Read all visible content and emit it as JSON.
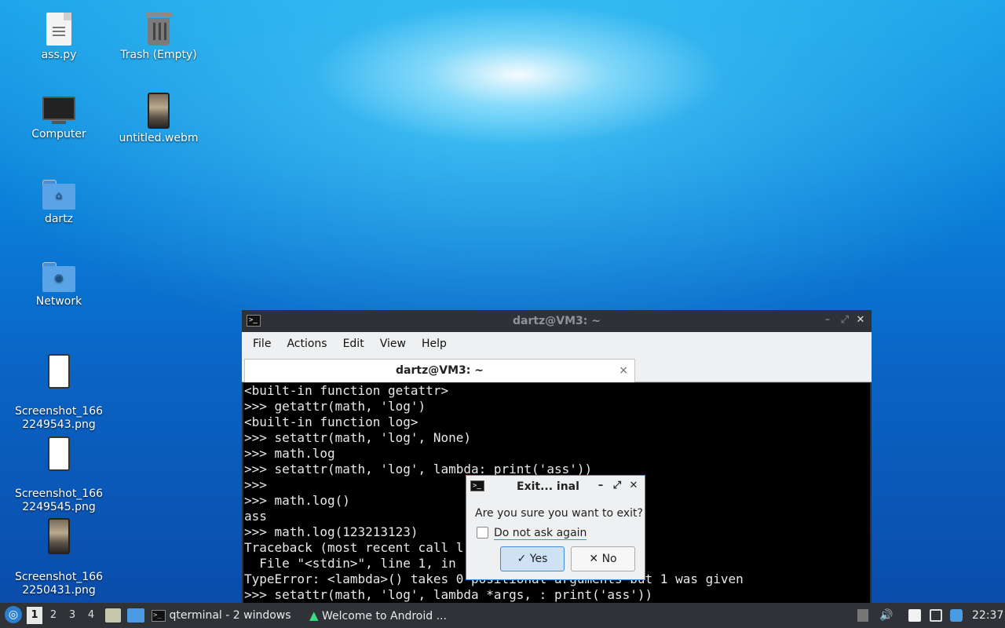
{
  "desktop": {
    "icons": [
      {
        "label": "ass.py",
        "icon": "python-file-icon"
      },
      {
        "label": "Trash (Empty)",
        "icon": "trash-icon"
      },
      {
        "label": "Computer",
        "icon": "computer-icon"
      },
      {
        "label": "untitled.webm",
        "icon": "video-file-icon"
      },
      {
        "label": "dartz",
        "icon": "home-folder-icon"
      },
      {
        "label": "Network",
        "icon": "network-folder-icon"
      },
      {
        "label": "Screenshot_166\n2249543.png",
        "icon": "image-file-icon"
      },
      {
        "label": "Screenshot_166\n2249545.png",
        "icon": "image-file-icon"
      },
      {
        "label": "Screenshot_166\n2250431.png",
        "icon": "image-file-icon"
      }
    ]
  },
  "terminal": {
    "title": "dartz@VM3: ~",
    "menu": [
      "File",
      "Actions",
      "Edit",
      "View",
      "Help"
    ],
    "tab_label": "dartz@VM3: ~",
    "tab_close": "×",
    "lines": [
      "<built-in function getattr>",
      ">>> getattr(math, 'log')",
      "<built-in function log>",
      ">>> setattr(math, 'log', None)",
      ">>> math.log",
      ">>> setattr(math, 'log', lambda: print('ass'))",
      ">>>",
      ">>> math.log()",
      "ass",
      ">>> math.log(123213123)",
      "Traceback (most recent call l",
      "  File \"<stdin>\", line 1, in",
      "TypeError: <lambda>() takes 0 positional arguments but 1 was given",
      ">>> setattr(math, 'log', lambda *args, : print('ass'))"
    ]
  },
  "dialog": {
    "title": "Exit... inal",
    "question": "Are you sure you want to exit?",
    "checkbox_label": "Do not ask again",
    "yes_label": "Yes",
    "no_label": "No",
    "accent": "#3d8ee0"
  },
  "taskbar": {
    "workspaces": [
      "1",
      "2",
      "3",
      "4"
    ],
    "active_workspace": "1",
    "task1": "qterminal - 2 windows",
    "task2": "Welcome to Android ...",
    "clock": "22:37"
  }
}
